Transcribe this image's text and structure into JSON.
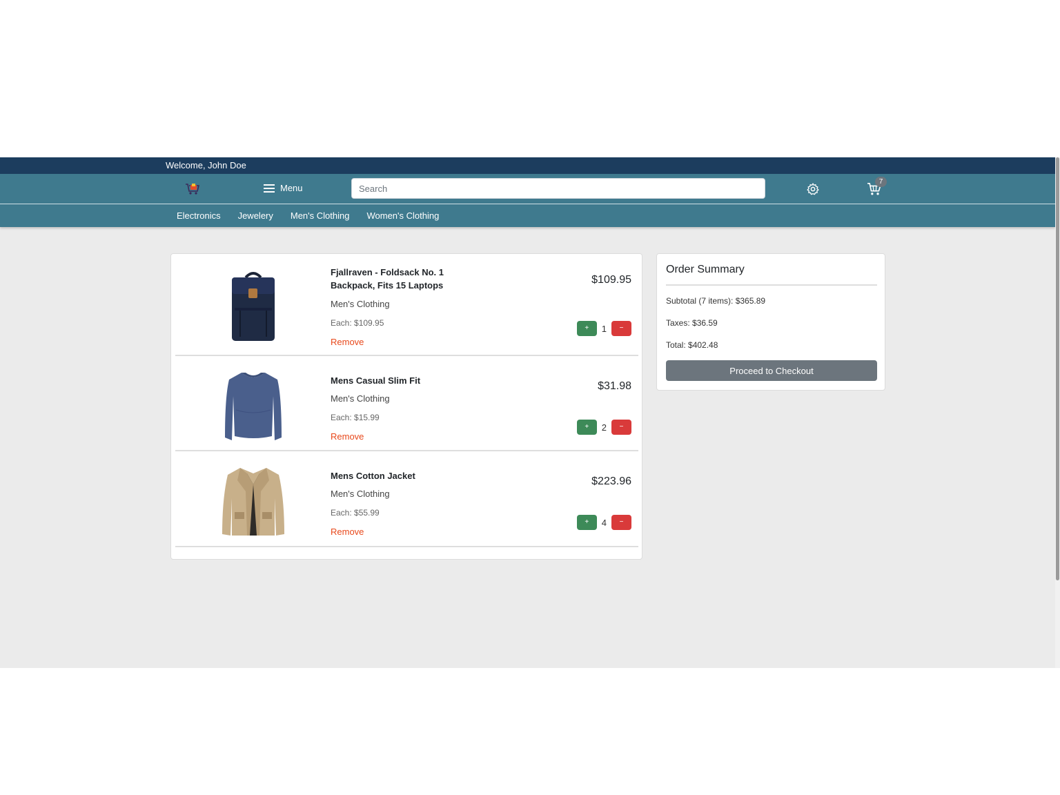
{
  "topbar": {
    "welcome": "Welcome, John Doe"
  },
  "navbar": {
    "menu_label": "Menu",
    "search_placeholder": "Search",
    "cart_count": "7"
  },
  "categories": [
    {
      "label": "Electronics"
    },
    {
      "label": "Jewelery"
    },
    {
      "label": "Men's Clothing"
    },
    {
      "label": "Women's Clothing"
    }
  ],
  "cart_items": [
    {
      "title": "Fjallraven - Foldsack No. 1 Backpack, Fits 15 Laptops",
      "category": "Men's Clothing",
      "each": "Each: $109.95",
      "remove": "Remove",
      "price": "$109.95",
      "qty": "1",
      "plus": "+",
      "minus": "−",
      "image": "backpack-image"
    },
    {
      "title": "Mens Casual Slim Fit",
      "category": "Men's Clothing",
      "each": "Each: $15.99",
      "remove": "Remove",
      "price": "$31.98",
      "qty": "2",
      "plus": "+",
      "minus": "−",
      "image": "shirt-image"
    },
    {
      "title": "Mens Cotton Jacket",
      "category": "Men's Clothing",
      "each": "Each: $55.99",
      "remove": "Remove",
      "price": "$223.96",
      "qty": "4",
      "plus": "+",
      "minus": "−",
      "image": "jacket-image"
    }
  ],
  "summary": {
    "title": "Order Summary",
    "subtotal": "Subtotal (7 items): $365.89",
    "taxes": "Taxes: $36.59",
    "total": "Total: $402.48",
    "checkout_label": "Proceed to Checkout"
  },
  "colors": {
    "topbar": "#1c3d5e",
    "navbar": "#3f7a8e",
    "background": "#ebebeb",
    "plus_button": "#3d8a58",
    "minus_button": "#d93a3a",
    "remove_link": "#e8481b",
    "checkout_button": "#6c757d"
  }
}
